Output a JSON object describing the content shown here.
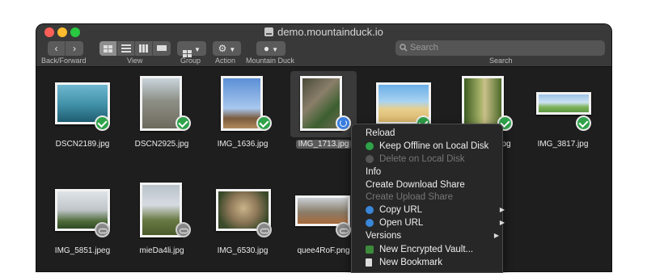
{
  "window": {
    "title": "demo.mountainduck.io"
  },
  "toolbar": {
    "back_forward_label": "Back/Forward",
    "view_label": "View",
    "group_label": "Group",
    "action_label": "Action",
    "mountain_duck_label": "Mountain Duck",
    "search_label": "Search",
    "search_placeholder": "Search"
  },
  "files": [
    {
      "name": "DSCN2189.jpg",
      "status": "offline"
    },
    {
      "name": "DSCN2925.jpg",
      "status": "offline"
    },
    {
      "name": "IMG_1636.jpg",
      "status": "offline"
    },
    {
      "name": "IMG_1713.jpg",
      "status": "syncing",
      "selected": true
    },
    {
      "name": "",
      "status": "offline"
    },
    {
      "name": "jpg",
      "status": "offline"
    },
    {
      "name": "IMG_3817.jpg",
      "status": "offline"
    },
    {
      "name": "IMG_5851.jpeg",
      "status": "cloud"
    },
    {
      "name": "mieDa4li.jpg",
      "status": "cloud"
    },
    {
      "name": "IMG_6530.jpg",
      "status": "cloud"
    },
    {
      "name": "quee4RoF.png",
      "status": "cloud"
    }
  ],
  "context_menu": {
    "items": [
      {
        "label": "Reload"
      },
      {
        "label": "Keep Offline on Local Disk",
        "icon": "green-check-icon"
      },
      {
        "label": "Delete on Local Disk",
        "icon": "gray-circle-icon",
        "disabled": true
      },
      {
        "label": "Info"
      },
      {
        "label": "Create Download Share"
      },
      {
        "label": "Create Upload Share",
        "disabled": true
      },
      {
        "label": "Copy URL",
        "icon": "globe-icon",
        "submenu": true
      },
      {
        "label": "Open URL",
        "icon": "globe-icon",
        "submenu": true
      },
      {
        "label": "Versions",
        "submenu": true
      },
      {
        "label": "New Encrypted Vault...",
        "icon": "vault-icon"
      },
      {
        "label": "New Bookmark",
        "icon": "bookmark-icon"
      }
    ]
  },
  "colors": {
    "accent": "#3a7ee0",
    "offline_badge": "#2fa24a",
    "cloud_badge": "#888888"
  }
}
